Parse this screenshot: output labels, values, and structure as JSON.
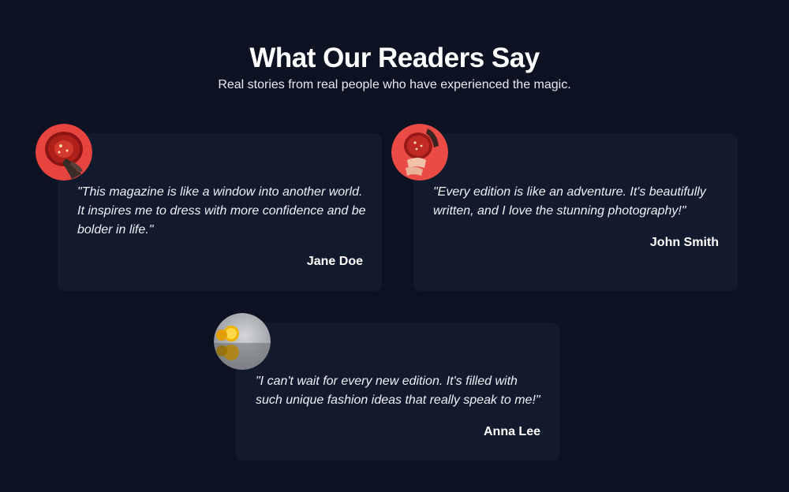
{
  "section": {
    "title": "What Our Readers Say",
    "subtitle": "Real stories from real people who have experienced the magic."
  },
  "testimonials": [
    {
      "quote": "\"This magazine is like a window into another world. It inspires me to dress with more confidence and be bolder in life.\"",
      "name": "Jane Doe",
      "avatar": "grapefruit-hand-photo"
    },
    {
      "quote": "\"Every edition is like an adventure. It's beautifully written, and I love the stunning photography!\"",
      "name": "John Smith",
      "avatar": "grapefruit-fingers-photo"
    },
    {
      "quote": "\"I can't wait for every new edition. It's filled with such unique fashion ideas that really speak to me!\"",
      "name": "Anna Lee",
      "avatar": "lemon-reflection-photo"
    }
  ],
  "colors": {
    "background": "#0d1223",
    "card": "#121a2e",
    "text": "#ffffff",
    "avatar_accent_red": "#e8443f"
  }
}
